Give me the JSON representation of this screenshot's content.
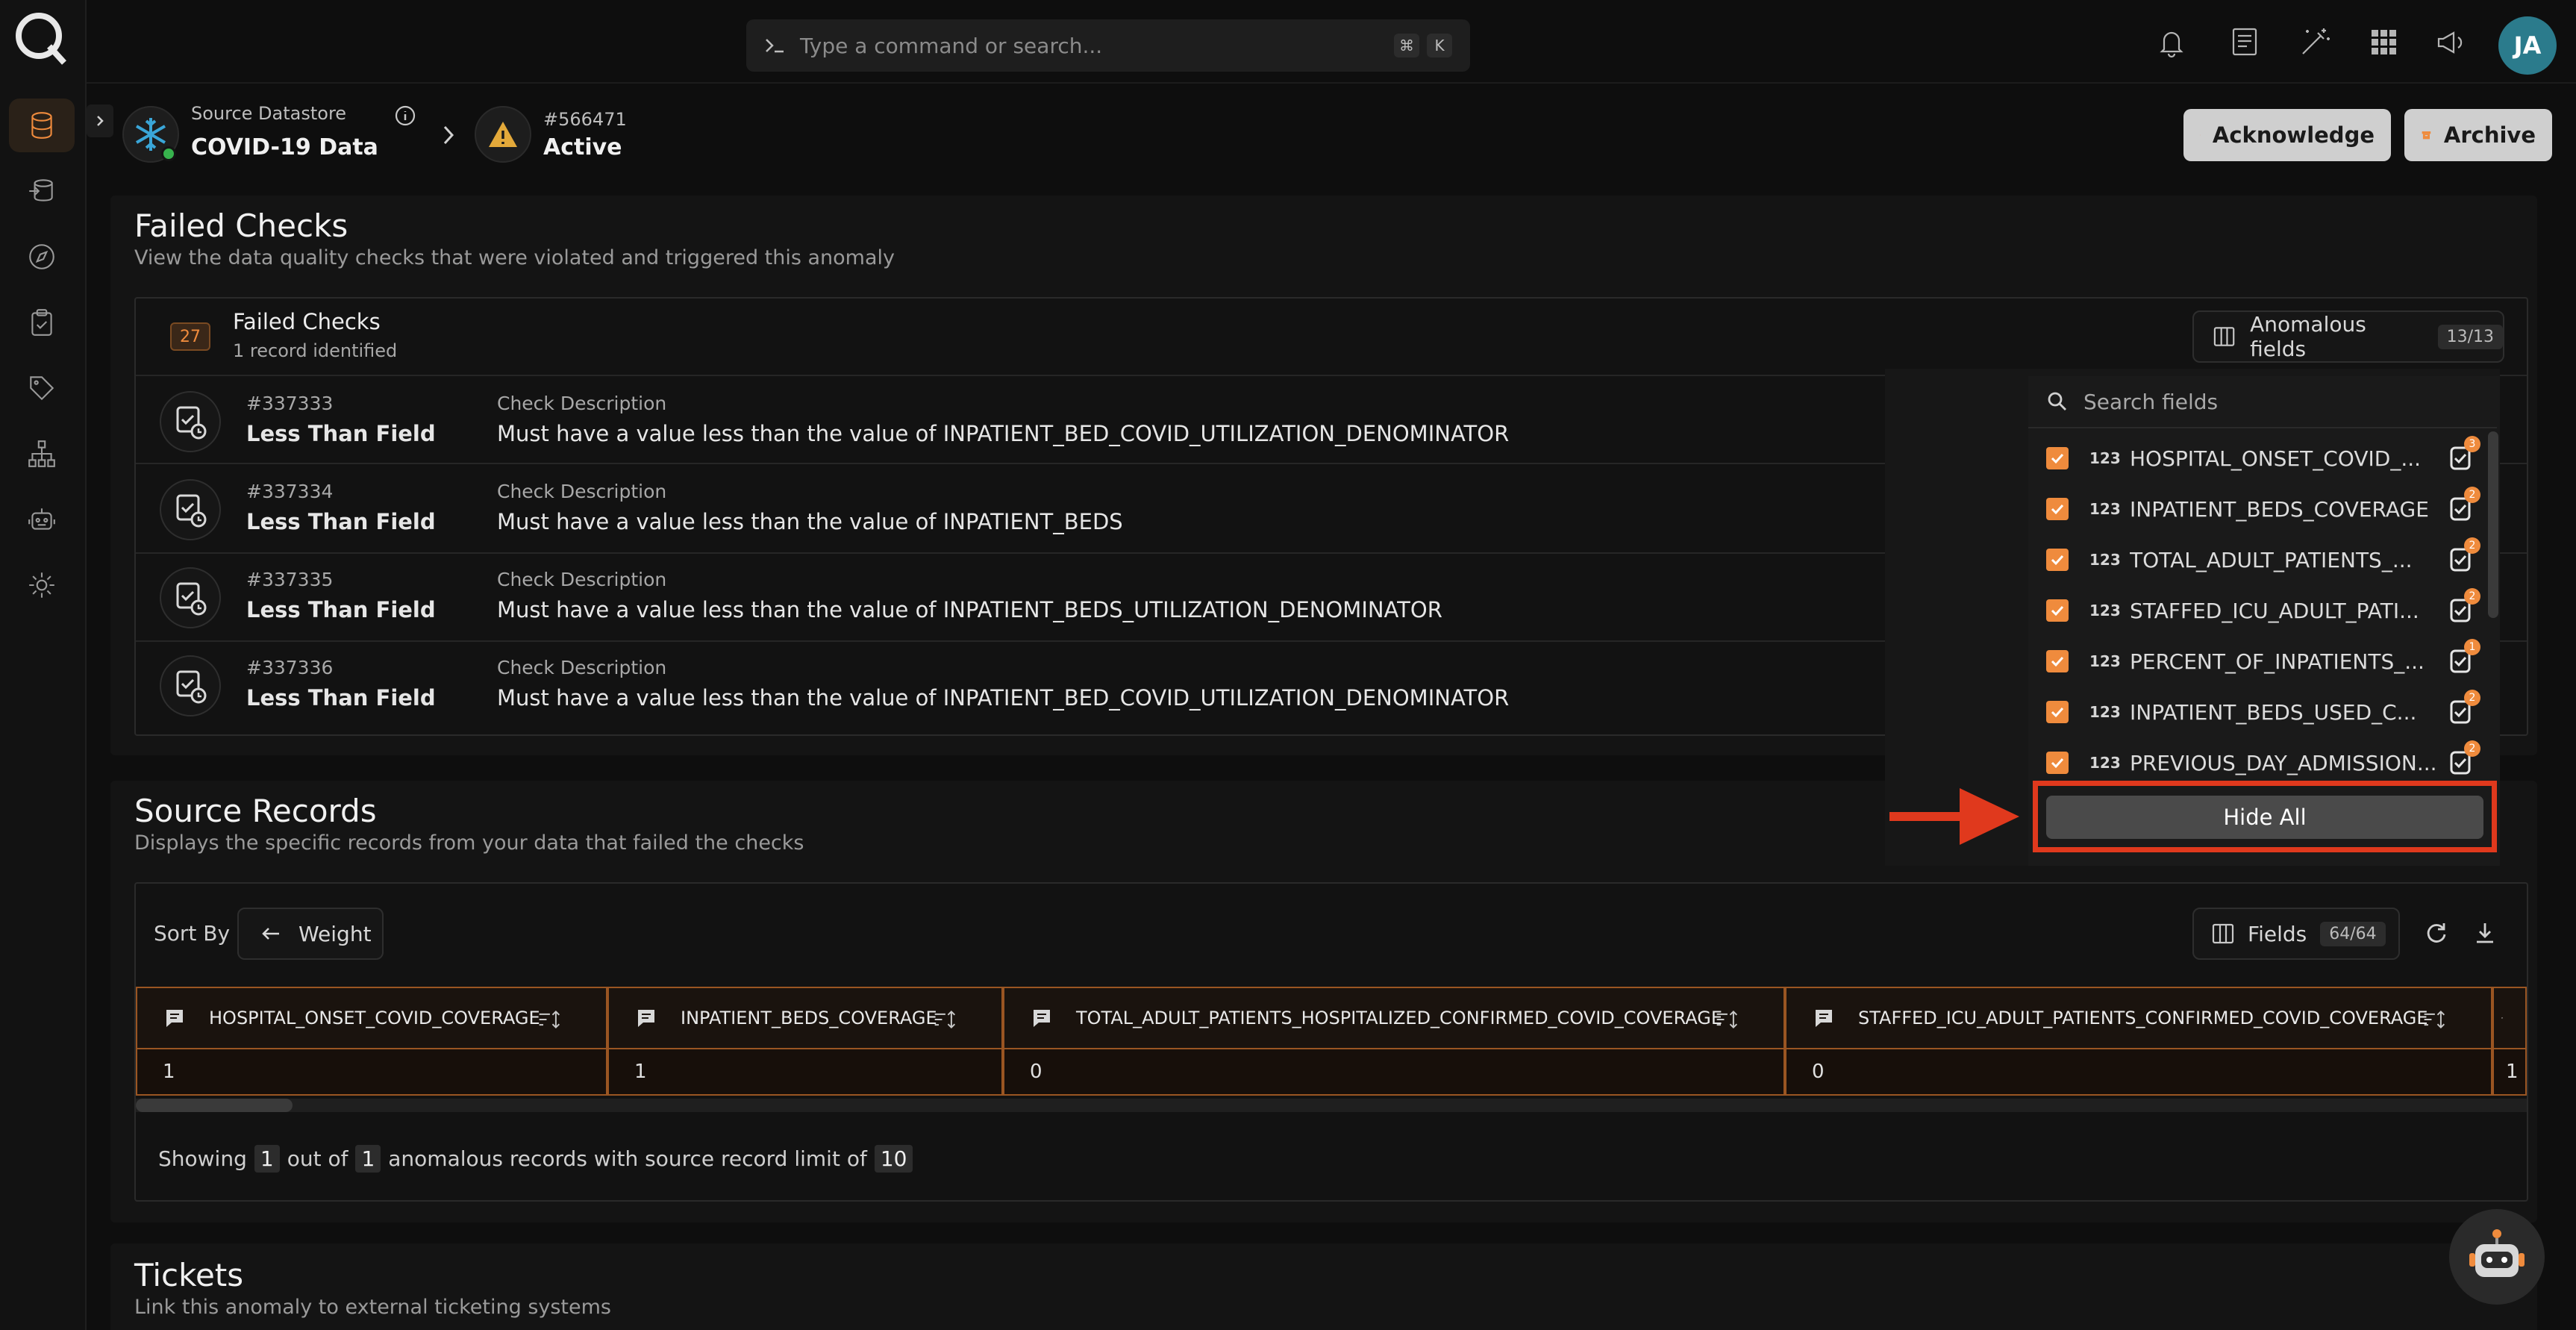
{
  "topbar": {
    "command_placeholder": "Type a command or search...",
    "shortcut_keys": [
      "⌘",
      "K"
    ],
    "avatar_initials": "JA"
  },
  "breadcrumb": {
    "datastore_label": "Source Datastore",
    "datastore_name": "COVID-19 Data",
    "anomaly_id": "#566471",
    "anomaly_status": "Active"
  },
  "actions": {
    "acknowledge": "Acknowledge",
    "archive": "Archive"
  },
  "failed_checks": {
    "title": "Failed Checks",
    "subtitle": "View the data quality checks that were violated and triggered this anomaly",
    "count": "27",
    "box_title": "Failed Checks",
    "box_sub": "1 record identified",
    "anomalous_fields_label": "Anomalous fields",
    "anomalous_fields_count": "13/13",
    "desc_label": "Check Description",
    "items": [
      {
        "id": "#337333",
        "name": "Less Than Field",
        "desc": "Must have a value less than the value of INPATIENT_BED_COVID_UTILIZATION_DENOMINATOR"
      },
      {
        "id": "#337334",
        "name": "Less Than Field",
        "desc": "Must have a value less than the value of INPATIENT_BEDS"
      },
      {
        "id": "#337335",
        "name": "Less Than Field",
        "desc": "Must have a value less than the value of INPATIENT_BEDS_UTILIZATION_DENOMINATOR"
      },
      {
        "id": "#337336",
        "name": "Less Than Field",
        "desc": "Must have a value less than the value of INPATIENT_BED_COVID_UTILIZATION_DENOMINATOR"
      }
    ]
  },
  "dropdown": {
    "search_placeholder": "Search fields",
    "type_label": "123",
    "hide_all": "Hide All",
    "fields": [
      {
        "name": "HOSPITAL_ONSET_COVID_...",
        "badge": "3"
      },
      {
        "name": "INPATIENT_BEDS_COVERAGE",
        "badge": "2"
      },
      {
        "name": "TOTAL_ADULT_PATIENTS_...",
        "badge": "2"
      },
      {
        "name": "STAFFED_ICU_ADULT_PATI...",
        "badge": "2"
      },
      {
        "name": "PERCENT_OF_INPATIENTS_...",
        "badge": "1"
      },
      {
        "name": "INPATIENT_BEDS_USED_C...",
        "badge": "2"
      },
      {
        "name": "PREVIOUS_DAY_ADMISSION...",
        "badge": "2"
      }
    ]
  },
  "source_records": {
    "title": "Source Records",
    "subtitle": "Displays the specific records from your data that failed the checks",
    "sort_by_label": "Sort By",
    "sort_value": "Weight",
    "fields_label": "Fields",
    "fields_count": "64/64",
    "columns": [
      {
        "name": "HOSPITAL_ONSET_COVID_COVERAGE",
        "value": "1"
      },
      {
        "name": "INPATIENT_BEDS_COVERAGE",
        "value": "1"
      },
      {
        "name": "TOTAL_ADULT_PATIENTS_HOSPITALIZED_CONFIRMED_COVID_COVERAGE",
        "value": "0"
      },
      {
        "name": "STAFFED_ICU_ADULT_PATIENTS_CONFIRMED_COVID_COVERAGE",
        "value": "0"
      },
      {
        "name": "",
        "value": "1"
      }
    ],
    "footer": {
      "showing": "Showing",
      "shown": "1",
      "out_of": "out of",
      "total": "1",
      "rest": "anomalous records with source record limit of",
      "limit": "10"
    }
  },
  "tickets": {
    "title": "Tickets",
    "subtitle": "Link this anomaly to external ticketing systems"
  },
  "colors": {
    "accent": "#ef8b3d",
    "highlight": "#e0391d",
    "background": "#0e0e0e"
  }
}
